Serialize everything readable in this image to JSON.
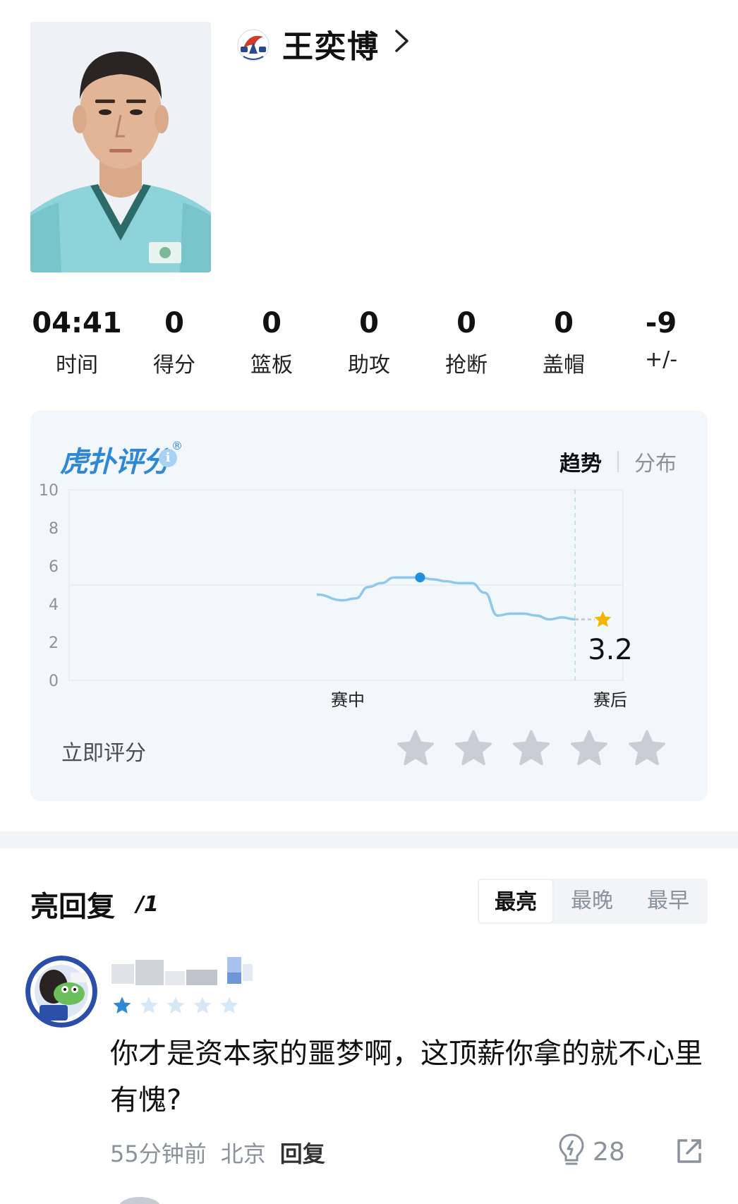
{
  "player": {
    "name": "王奕博",
    "photo_icon": "player-headshot",
    "team_logo_icon": "qingdao-eagle-logo",
    "chevron_icon": "chevron-right-icon"
  },
  "stats": [
    {
      "value": "04:41",
      "label": "时间"
    },
    {
      "value": "0",
      "label": "得分"
    },
    {
      "value": "0",
      "label": "篮板"
    },
    {
      "value": "0",
      "label": "助攻"
    },
    {
      "value": "0",
      "label": "抢断"
    },
    {
      "value": "0",
      "label": "盖帽"
    },
    {
      "value": "-9",
      "label": "+/-"
    }
  ],
  "rating": {
    "logo_text": "虎扑评分",
    "logo_reg": "®",
    "info_icon": "i",
    "tab_active": "趋势",
    "tab_inactive": "分布",
    "rate_now": "立即评分",
    "star_count": 5,
    "accent": "#2f88d6"
  },
  "chart_data": {
    "type": "line",
    "ylim": [
      0,
      10
    ],
    "y_ticks": [
      "10",
      "8",
      "6",
      "4",
      "2",
      "0"
    ],
    "x_labels": [
      "赛中",
      "赛后"
    ],
    "series": [
      {
        "x": [
          0.0,
          0.1,
          0.15,
          0.2,
          0.25,
          0.3,
          0.35,
          0.4,
          0.45,
          0.5,
          0.55,
          0.6,
          0.65,
          0.7,
          0.75,
          0.8,
          0.85,
          0.9,
          0.95,
          1.0
        ],
        "values": [
          4.5,
          4.2,
          4.3,
          4.9,
          5.1,
          5.4,
          5.4,
          5.4,
          5.3,
          5.2,
          5.1,
          5.1,
          4.6,
          3.4,
          3.5,
          3.5,
          3.4,
          3.2,
          3.3,
          3.2
        ]
      }
    ],
    "highlight_index": 7,
    "final_value": "3.2",
    "line_color": "#8fc8ec",
    "dot_color": "#1f8fe0",
    "final_star_color": "#f5b400"
  },
  "replies": {
    "title": "亮回复",
    "count": "/1",
    "tabs": [
      "最亮",
      "最晚",
      "最早"
    ],
    "active_tab": 0
  },
  "comment": {
    "user_rating": 1,
    "text": "你才是资本家的噩梦啊，这顶薪你拿的就不心里有愧?",
    "time": "55分钟前",
    "location": "北京",
    "reply_label": "回复",
    "lights": "28",
    "light_icon": "lightbulb-icon",
    "share_icon": "share-icon"
  }
}
